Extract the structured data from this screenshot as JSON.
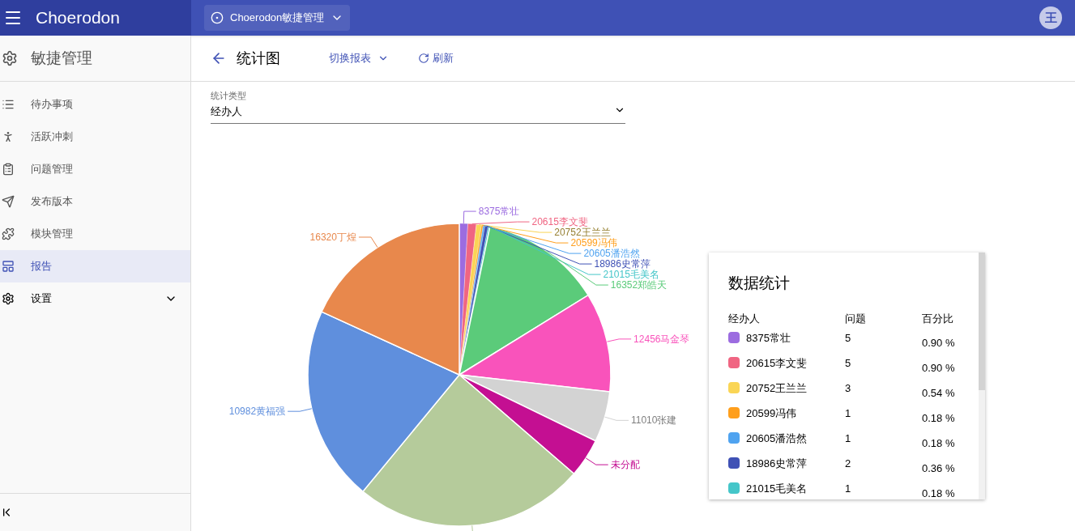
{
  "header": {
    "brand": "Choerodon",
    "project": "Choerodon敏捷管理",
    "avatar": "王"
  },
  "sidebar": {
    "title": "敏捷管理",
    "items": [
      {
        "label": "待办事项",
        "selected": false
      },
      {
        "label": "活跃冲刺",
        "selected": false
      },
      {
        "label": "问题管理",
        "selected": false
      },
      {
        "label": "发布版本",
        "selected": false
      },
      {
        "label": "模块管理",
        "selected": false
      },
      {
        "label": "报告",
        "selected": true
      },
      {
        "label": "设置",
        "selected": false,
        "expanded": false
      }
    ]
  },
  "toolbar": {
    "title": "统计图",
    "switch": "切换报表",
    "refresh": "刷新"
  },
  "select": {
    "label": "统计类型",
    "value": "经办人"
  },
  "chart_data": {
    "type": "pie",
    "categories": [
      "8375常壮",
      "20615李文斐",
      "20752王兰兰",
      "20599冯伟",
      "20605潘浩然",
      "18986史常萍",
      "21015毛美名",
      "16352郑皓天",
      "12456马金琴",
      "11010张建",
      "未分配",
      null,
      "10982黄福强",
      "16320丁煌"
    ],
    "values": [
      0.9,
      0.9,
      0.54,
      0.18,
      0.18,
      0.36,
      0.18,
      12.95,
      10.61,
      5.4,
      4.14,
      24.64,
      20.86,
      18.16
    ],
    "colors": [
      "#9c6ce0",
      "#f06582",
      "#fad555",
      "#ff9f1c",
      "#4fa3f0",
      "#3f51b5",
      "#45c6c9",
      "#5bcb7a",
      "#f953bb",
      "#d3d3d3",
      "#c40f92",
      "#b5cb9b",
      "#5f8fdd",
      "#e8884c"
    ]
  },
  "stats": {
    "title": "数据统计",
    "columns": [
      "经办人",
      "问题",
      "百分比"
    ],
    "rows": [
      {
        "name": "8375常壮",
        "color": "#9c6ce0",
        "count": "5",
        "percent": "0.90 %"
      },
      {
        "name": "20615李文斐",
        "color": "#f06582",
        "count": "5",
        "percent": "0.90 %"
      },
      {
        "name": "20752王兰兰",
        "color": "#fad555",
        "count": "3",
        "percent": "0.54 %"
      },
      {
        "name": "20599冯伟",
        "color": "#ff9f1c",
        "count": "1",
        "percent": "0.18 %"
      },
      {
        "name": "20605潘浩然",
        "color": "#4fa3f0",
        "count": "1",
        "percent": "0.18 %"
      },
      {
        "name": "18986史常萍",
        "color": "#3f51b5",
        "count": "2",
        "percent": "0.36 %"
      },
      {
        "name": "21015毛美名",
        "color": "#45c6c9",
        "count": "1",
        "percent": "0.18 %"
      }
    ]
  }
}
